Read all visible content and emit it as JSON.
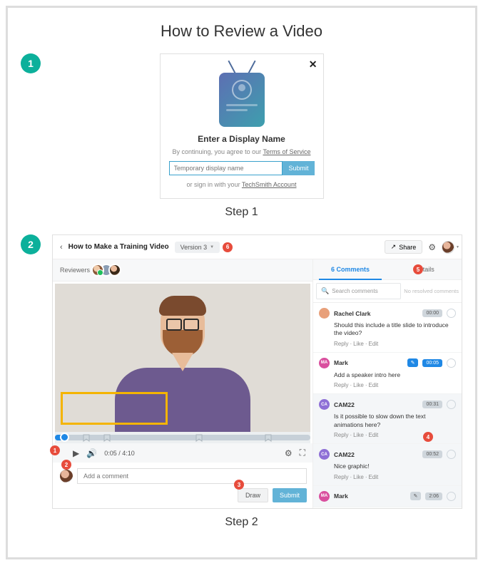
{
  "page_title": "How to Review a Video",
  "step1": {
    "badge": "1",
    "label": "Step 1",
    "modal_title": "Enter a Display Name",
    "agree_prefix": "By continuing, you agree to our ",
    "tos": "Terms of Service",
    "placeholder": "Temporary display name",
    "submit": "Submit",
    "signin_prefix": "or sign in with your ",
    "account_link": "TechSmith Account"
  },
  "step2": {
    "badge": "2",
    "label": "Step 2",
    "topbar": {
      "title": "How to Make a Training Video",
      "version": "Version 3",
      "share": "Share"
    },
    "reviewers_label": "Reviewers",
    "time": "0:05 / 4:10",
    "comment_placeholder": "Add a comment",
    "draw": "Draw",
    "submit": "Submit",
    "tabs": {
      "comments_count": "6 Comments",
      "details": "Details"
    },
    "search_placeholder": "Search comments",
    "no_resolved": "No resolved comments",
    "comments": [
      {
        "av": "rc",
        "av_txt": "",
        "name": "Rachel Clark",
        "ts": "00:00",
        "body": "Should this include a title slide to introduce the video?",
        "pencil": false,
        "blue_ts": false
      },
      {
        "av": "mk",
        "av_txt": "MA",
        "name": "Mark",
        "ts": "00:05",
        "body": "Add a speaker intro here",
        "pencil": true,
        "blue_ts": true
      },
      {
        "av": "ca",
        "av_txt": "CA",
        "name": "CAM22",
        "ts": "00:31",
        "body": "Is it possible to slow down the text animations here?",
        "pencil": false,
        "blue_ts": false,
        "hl": true
      },
      {
        "av": "ca",
        "av_txt": "CA",
        "name": "CAM22",
        "ts": "00:52",
        "body": "Nice graphic!",
        "pencil": false,
        "blue_ts": false,
        "hl": true
      },
      {
        "av": "mk",
        "av_txt": "MA",
        "name": "Mark",
        "ts": "2:06",
        "body": "",
        "pencil": true,
        "pencil_gray": true,
        "blue_ts": false,
        "hl": true
      }
    ],
    "reply": "Reply",
    "like": "Like",
    "edit": "Edit",
    "callouts": {
      "c1": "1",
      "c2": "2",
      "c3": "3",
      "c4": "4",
      "c5": "5",
      "c6": "6"
    }
  }
}
